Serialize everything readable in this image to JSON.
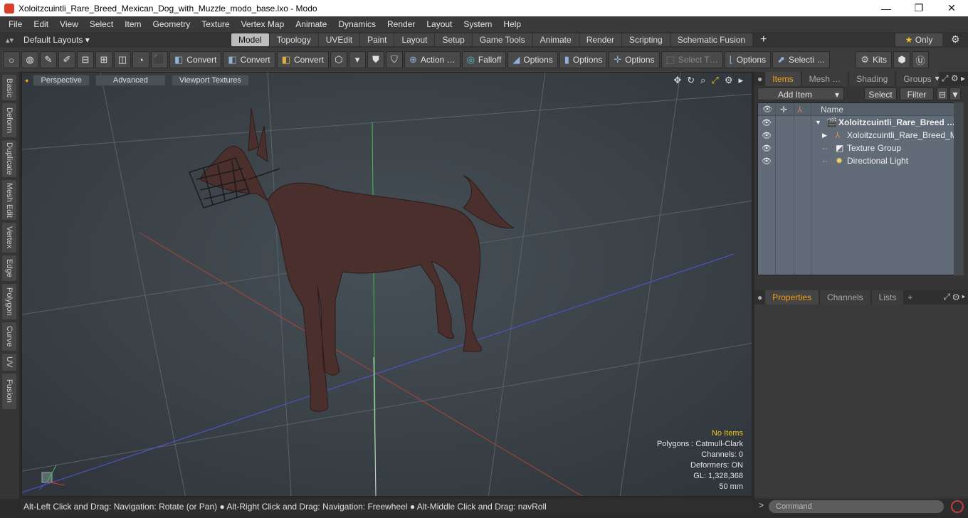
{
  "window": {
    "title": "Xoloitzcuintli_Rare_Breed_Mexican_Dog_with_Muzzle_modo_base.lxo - Modo",
    "minimize": "—",
    "maximize": "❐",
    "close": "✕"
  },
  "menu": [
    "File",
    "Edit",
    "View",
    "Select",
    "Item",
    "Geometry",
    "Texture",
    "Vertex Map",
    "Animate",
    "Dynamics",
    "Render",
    "Layout",
    "System",
    "Help"
  ],
  "layout": {
    "selector": "Default Layouts ▾",
    "tabs": [
      "Model",
      "Topology",
      "UVEdit",
      "Paint",
      "Layout",
      "Setup",
      "Game Tools",
      "Animate",
      "Render",
      "Scripting",
      "Schematic Fusion"
    ],
    "active_tab": "Model",
    "add": "+",
    "only": "Only"
  },
  "toolbar": {
    "convert1": "Convert",
    "convert2": "Convert",
    "convert3": "Convert",
    "action": "Action …",
    "falloff": "Falloff",
    "options1": "Options",
    "options2": "Options",
    "options3": "Options",
    "select_t": "Select T…",
    "options4": "Options",
    "selecti": "Selecti …",
    "kits": "Kits"
  },
  "left_tabs": [
    "Basic",
    "Deform",
    "Duplicate",
    "Mesh Edit",
    "Vertex",
    "Edge",
    "Polygon",
    "Curve",
    "UV",
    "Fusion"
  ],
  "viewport": {
    "view": "Perspective",
    "shading": "Advanced",
    "textures": "Viewport Textures",
    "stats": {
      "selection": "No Items",
      "polygons": "Polygons : Catmull-Clark",
      "channels": "Channels: 0",
      "deformers": "Deformers: ON",
      "gl": "GL: 1,328,368",
      "scale": "50 mm"
    },
    "axis_x": "X",
    "axis_y": "Y"
  },
  "status": "Alt-Left Click and Drag: Navigation: Rotate (or Pan) ● Alt-Right Click and Drag: Navigation: Freewheel ● Alt-Middle Click and Drag: navRoll",
  "items_panel": {
    "tabs": [
      "Items",
      "Mesh …",
      "Shading",
      "Groups"
    ],
    "active": "Items",
    "add_item": "Add Item",
    "select": "Select",
    "filter": "Filter",
    "name_header": "Name",
    "tree": [
      {
        "label": "Xoloitzcuintli_Rare_Breed …"
      },
      {
        "label": "Xoloitzcuintli_Rare_Breed_M…"
      },
      {
        "label": "Texture Group"
      },
      {
        "label": "Directional Light"
      }
    ]
  },
  "properties_panel": {
    "tabs": [
      "Properties",
      "Channels",
      "Lists"
    ],
    "active": "Properties",
    "add": "+"
  },
  "command": {
    "placeholder": "Command",
    "prompt": ">"
  },
  "colors": {
    "accent": "#f0a020",
    "viewport_bg": "#3e4449",
    "dog_body": "#4a2f2d"
  }
}
